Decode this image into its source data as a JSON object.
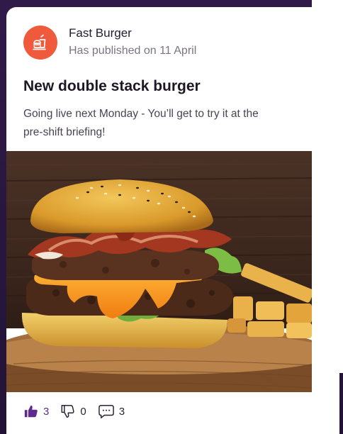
{
  "post": {
    "author": "Fast Burger",
    "published": "Has published on 11 April",
    "avatar_icon": "fast-food-icon",
    "avatar_color": "#f05a3c",
    "title": "New double stack burger",
    "body_lines": [
      "Going live next Monday - You’ll get to try it at the",
      "pre-shift briefing!"
    ],
    "image": "burger-photo"
  },
  "actions": {
    "likes": "3",
    "dislikes": "0",
    "comments": "3",
    "like_icon": "thumbs-up-icon",
    "dislike_icon": "thumbs-down-icon",
    "comment_icon": "comment-icon",
    "active_color": "#5e2a8c"
  }
}
